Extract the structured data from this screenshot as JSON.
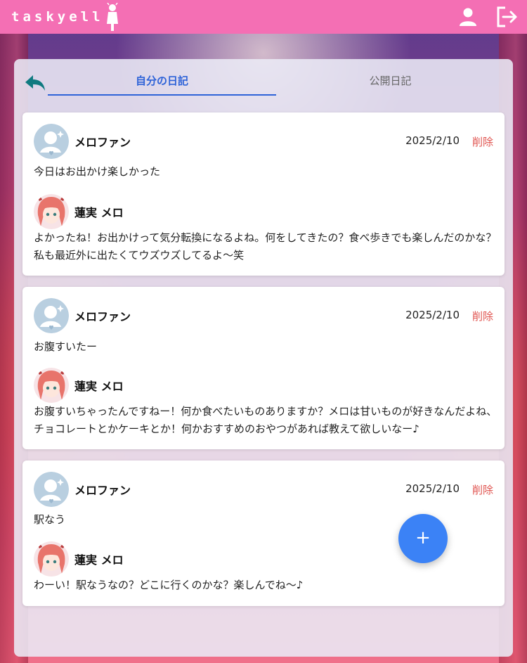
{
  "app": {
    "logo": "taskyell"
  },
  "header": {
    "icons": [
      "user-icon",
      "logout-icon"
    ]
  },
  "tabs": [
    {
      "label": "自分の日記",
      "active": true
    },
    {
      "label": "公開日記",
      "active": false
    }
  ],
  "entries": [
    {
      "user_name": "メロファン",
      "date": "2025/2/10",
      "delete_label": "削除",
      "text": "今日はお出かけ楽しかった",
      "reply_name": "蓮実 メロ",
      "reply": "よかったね！お出かけって気分転換になるよね。何をしてきたの？食べ歩きでも楽しんだのかな？私も最近外に出たくてウズウズしてるよ〜笑"
    },
    {
      "user_name": "メロファン",
      "date": "2025/2/10",
      "delete_label": "削除",
      "text": "お腹すいたー",
      "reply_name": "蓮実 メロ",
      "reply": "お腹すいちゃったんですねー！何か食べたいものありますか？メロは甘いものが好きなんだよね、チョコレートとかケーキとか！何かおすすめのおやつがあれば教えて欲しいなー♪"
    },
    {
      "user_name": "メロファン",
      "date": "2025/2/10",
      "delete_label": "削除",
      "text": "駅なう",
      "reply_name": "蓮実 メロ",
      "reply": "わーい！駅なうなの？どこに行くのかな？楽しんでね〜♪"
    }
  ],
  "fab": {
    "label": "+"
  },
  "colors": {
    "header": "#f46fb4",
    "accent": "#2e63d8",
    "delete": "#e0534f",
    "fab": "#3b82f6"
  }
}
